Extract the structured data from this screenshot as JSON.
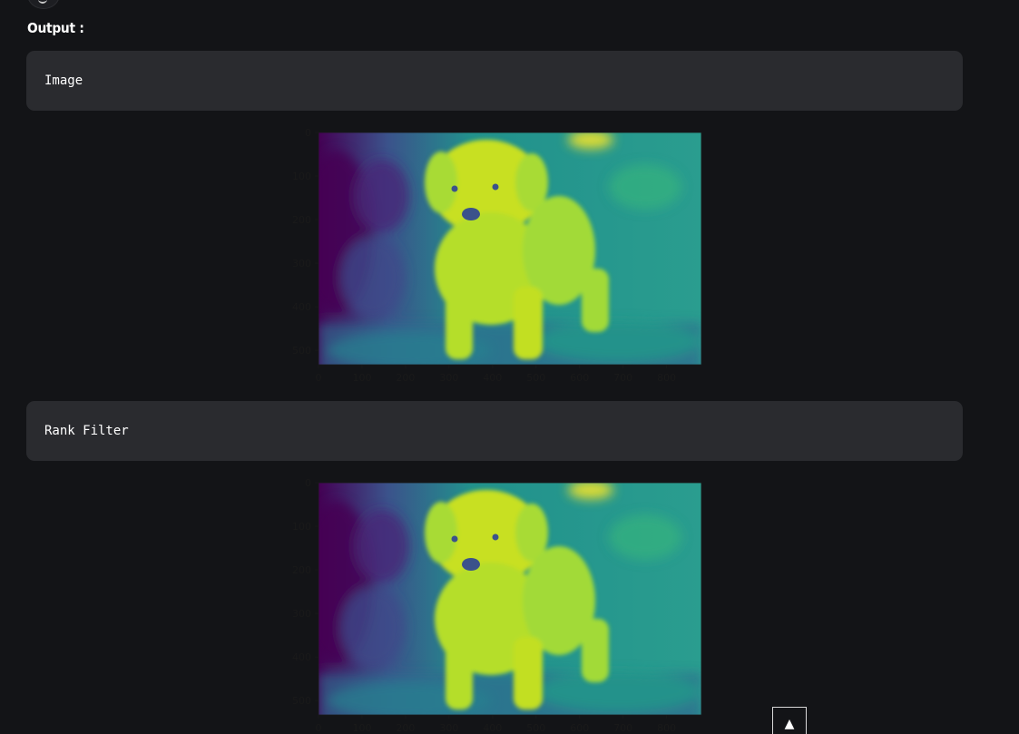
{
  "output_label": "Output :",
  "blocks": [
    {
      "code": "Image"
    },
    {
      "code": "Rank Filter"
    }
  ],
  "plot_axes": {
    "x_ticks": [
      "0",
      "100",
      "200",
      "300",
      "400",
      "500",
      "600",
      "700",
      "800"
    ],
    "y_ticks": [
      "0",
      "100",
      "200",
      "300",
      "400",
      "500"
    ],
    "x_range": [
      0,
      880
    ],
    "y_range": [
      0,
      533
    ]
  },
  "scroll_top": {
    "glyph": "▲"
  },
  "colors": {
    "page_bg": "#131417",
    "block_bg": "#2a2b2f",
    "tick_text": "#1a1a1a",
    "viridis_dark": "#440154",
    "viridis_mid": "#21918c",
    "viridis_light": "#fde725"
  }
}
